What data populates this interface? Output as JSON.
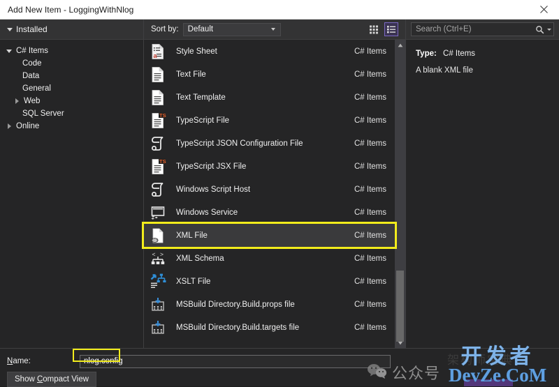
{
  "window": {
    "title": "Add New Item - LoggingWithNlog",
    "close_label": "×"
  },
  "left_pane": {
    "header": "Installed",
    "tree": [
      {
        "label": "C# Items",
        "level": 0,
        "expander": "down",
        "icon": "chevron-down-icon"
      },
      {
        "label": "Code",
        "level": 1,
        "expander": "none",
        "icon": ""
      },
      {
        "label": "Data",
        "level": 1,
        "expander": "none",
        "icon": ""
      },
      {
        "label": "General",
        "level": 1,
        "expander": "none",
        "icon": ""
      },
      {
        "label": "Web",
        "level": 1,
        "expander": "right",
        "icon": "chevron-right-icon"
      },
      {
        "label": "SQL Server",
        "level": 1,
        "expander": "none",
        "icon": ""
      },
      {
        "label": "Online",
        "level": 0,
        "expander": "right",
        "icon": "chevron-right-icon"
      }
    ]
  },
  "toolbar": {
    "sort_by_label": "Sort by:",
    "sort_by_value": "Default",
    "grid_view_name": "grid-view-icon",
    "list_view_name": "list-view-icon"
  },
  "list": {
    "items": [
      {
        "name": "Style Sheet",
        "category": "C# Items",
        "icon": "style-sheet-icon",
        "selected": false
      },
      {
        "name": "Text File",
        "category": "C# Items",
        "icon": "text-file-icon",
        "selected": false
      },
      {
        "name": "Text Template",
        "category": "C# Items",
        "icon": "text-template-icon",
        "selected": false
      },
      {
        "name": "TypeScript File",
        "category": "C# Items",
        "icon": "typescript-file-icon",
        "selected": false
      },
      {
        "name": "TypeScript JSON Configuration File",
        "category": "C# Items",
        "icon": "typescript-json-icon",
        "selected": false
      },
      {
        "name": "TypeScript JSX File",
        "category": "C# Items",
        "icon": "typescript-jsx-icon",
        "selected": false
      },
      {
        "name": "Windows Script Host",
        "category": "C# Items",
        "icon": "windows-script-host-icon",
        "selected": false
      },
      {
        "name": "Windows Service",
        "category": "C# Items",
        "icon": "windows-service-icon",
        "selected": false
      },
      {
        "name": "XML File",
        "category": "C# Items",
        "icon": "xml-file-icon",
        "selected": true
      },
      {
        "name": "XML Schema",
        "category": "C# Items",
        "icon": "xml-schema-icon",
        "selected": false
      },
      {
        "name": "XSLT File",
        "category": "C# Items",
        "icon": "xslt-file-icon",
        "selected": false
      },
      {
        "name": "MSBuild Directory.Build.props file",
        "category": "C# Items",
        "icon": "msbuild-props-icon",
        "selected": false
      },
      {
        "name": "MSBuild Directory.Build.targets file",
        "category": "C# Items",
        "icon": "msbuild-targets-icon",
        "selected": false
      }
    ]
  },
  "right_pane": {
    "search_placeholder": "Search (Ctrl+E)",
    "detail_type_label": "Type:",
    "detail_type_value": "C# Items",
    "detail_description": "A blank XML file"
  },
  "footer": {
    "name_label": "Name:",
    "name_value": "nlog.config",
    "compact_button": "Show Compact View"
  },
  "watermark": {
    "wechat_text": "公众号",
    "brand_cn": "开发者",
    "brand_en": "DevZe.CoM",
    "ghost_text": "架构师宝典"
  },
  "colors": {
    "highlight": "#f2ec1c",
    "accent_purple": "#7b68c4",
    "dialog_bg": "#252526",
    "toolbar_bg": "#333334"
  }
}
